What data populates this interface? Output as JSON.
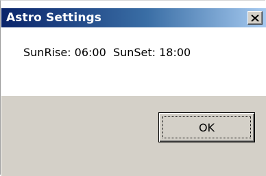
{
  "window": {
    "title": "Astro Settings",
    "close_icon": "close-icon"
  },
  "content": {
    "message": "SunRise: 06:00  SunSet: 18:00"
  },
  "footer": {
    "ok_label": "OK"
  },
  "colors": {
    "title_gradient_start": "#0a246a",
    "title_gradient_end": "#a6caf0",
    "dialog_face": "#d4d0c8"
  }
}
